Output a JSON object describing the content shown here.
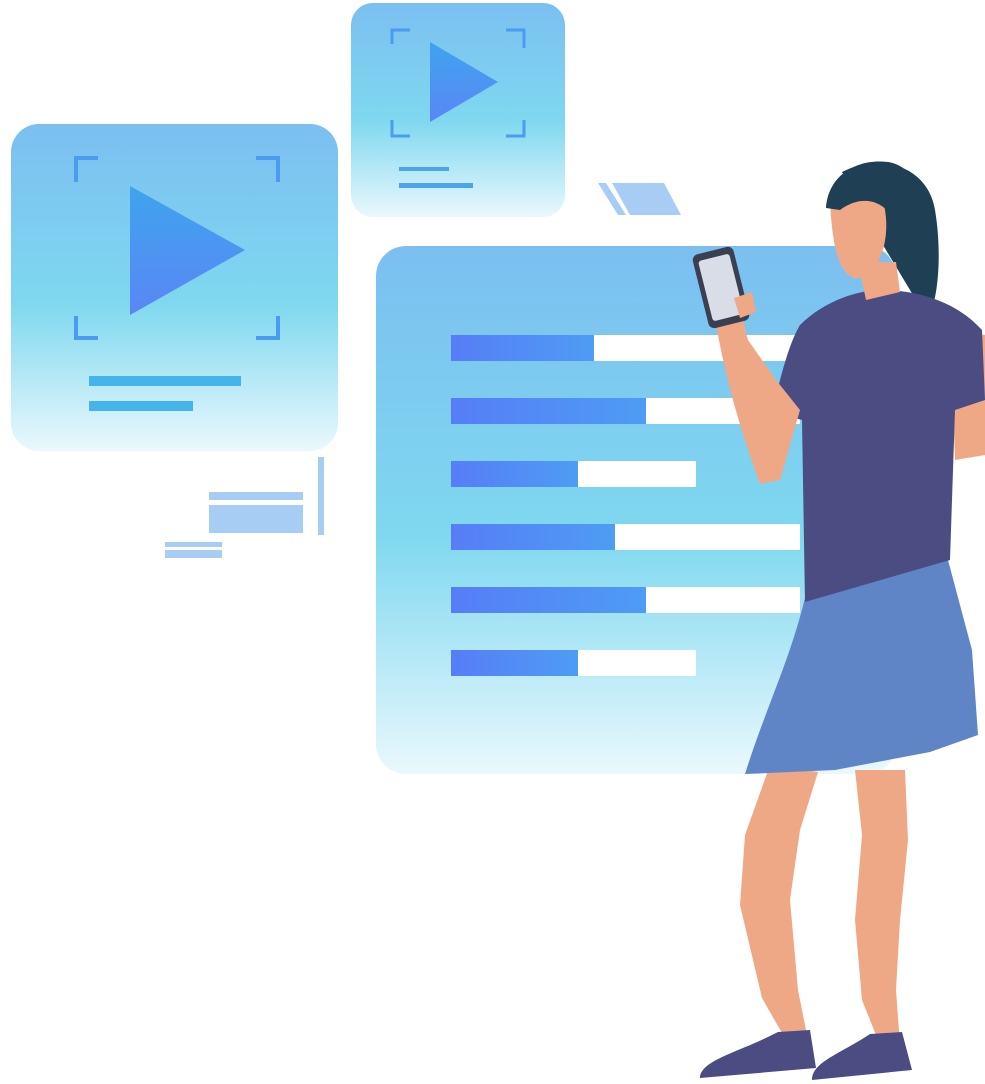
{
  "heading": {
    "text": ""
  },
  "colors": {
    "card_top": "#7bbff1",
    "card_mid": "#7fd8ef",
    "card_bottom": "#eaf8fd",
    "play": "#4a9cf2",
    "bar_fill": "#4f83f7",
    "bar_track": "#ffffff",
    "hair": "#1f3f54",
    "skin": "#eea886",
    "shirt": "#4a4c82",
    "skirt": "#5f85c6",
    "shoe": "#4a4c82"
  },
  "icons": {
    "large_card": "play-icon",
    "small_card": "play-icon",
    "phone": "smartphone-icon"
  },
  "bars": [
    {
      "fill": 0.41
    },
    {
      "fill": 0.56
    },
    {
      "fill": 0.52
    },
    {
      "fill": 0.47
    },
    {
      "fill": 0.56
    },
    {
      "fill": 0.52
    }
  ]
}
